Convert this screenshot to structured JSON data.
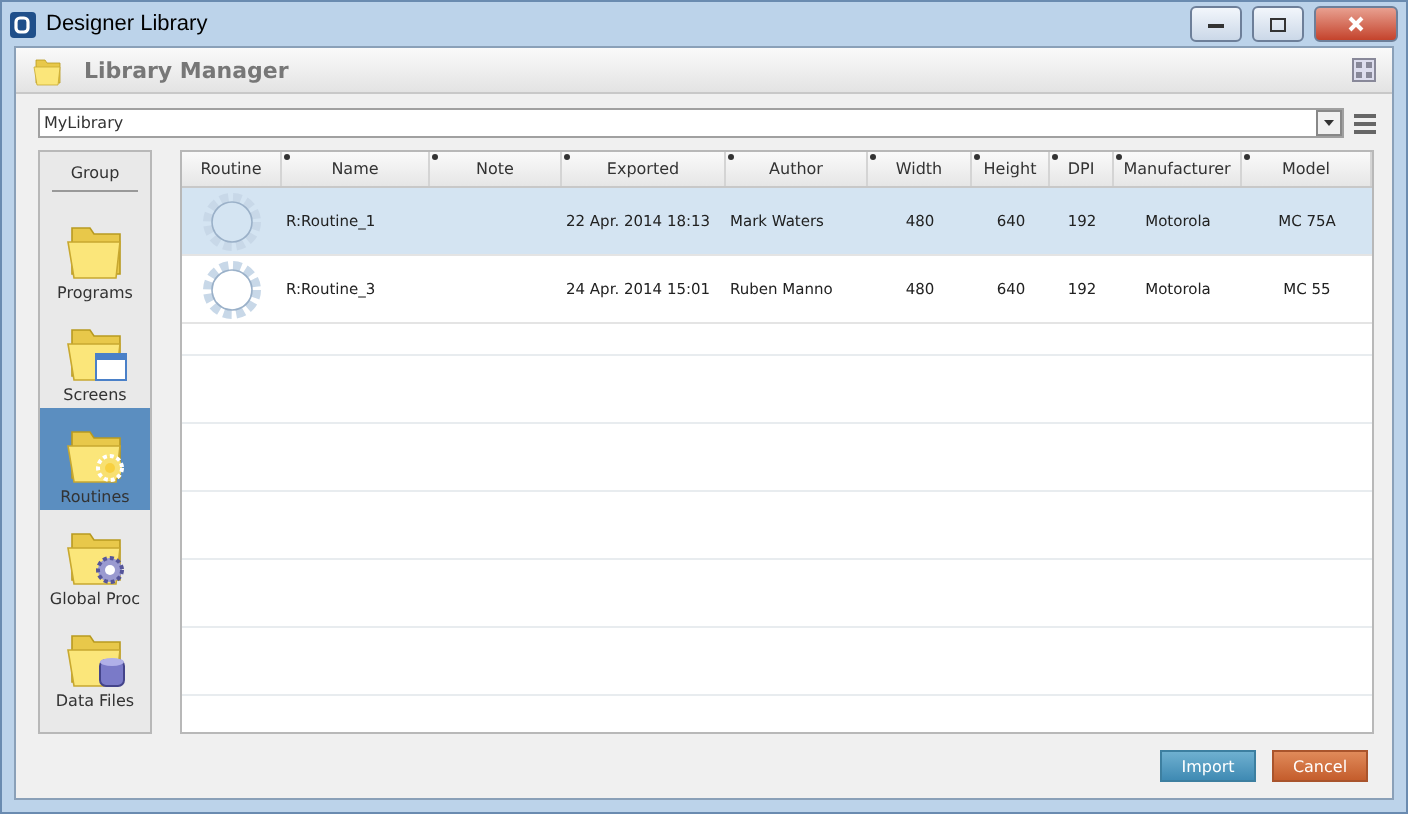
{
  "window": {
    "title": "Designer Library"
  },
  "header": {
    "title": "Library Manager"
  },
  "library_select": {
    "value": "MyLibrary"
  },
  "sidebar": {
    "title": "Group",
    "items": [
      {
        "label": "Programs",
        "kind": "plain",
        "selected": false
      },
      {
        "label": "Screens",
        "kind": "screen",
        "selected": false
      },
      {
        "label": "Routines",
        "kind": "routine",
        "selected": true
      },
      {
        "label": "Global Proc",
        "kind": "gear",
        "selected": false
      },
      {
        "label": "Data Files",
        "kind": "data",
        "selected": false
      }
    ]
  },
  "table": {
    "columns": [
      "Routine",
      "Name",
      "Note",
      "Exported",
      "Author",
      "Width",
      "Height",
      "DPI",
      "Manufacturer",
      "Model"
    ],
    "rows": [
      {
        "selected": true,
        "cells": [
          "",
          "R:Routine_1",
          "",
          "22 Apr. 2014 18:13",
          "Mark Waters",
          "480",
          "640",
          "192",
          "Motorola",
          "MC 75A"
        ]
      },
      {
        "selected": false,
        "cells": [
          "",
          "R:Routine_3",
          "",
          "24 Apr. 2014 15:01",
          "Ruben Manno",
          "480",
          "640",
          "192",
          "Motorola",
          "MC 55"
        ]
      }
    ]
  },
  "buttons": [
    {
      "label": "Import",
      "kind": "primary"
    },
    {
      "label": "Cancel",
      "kind": "danger"
    }
  ]
}
